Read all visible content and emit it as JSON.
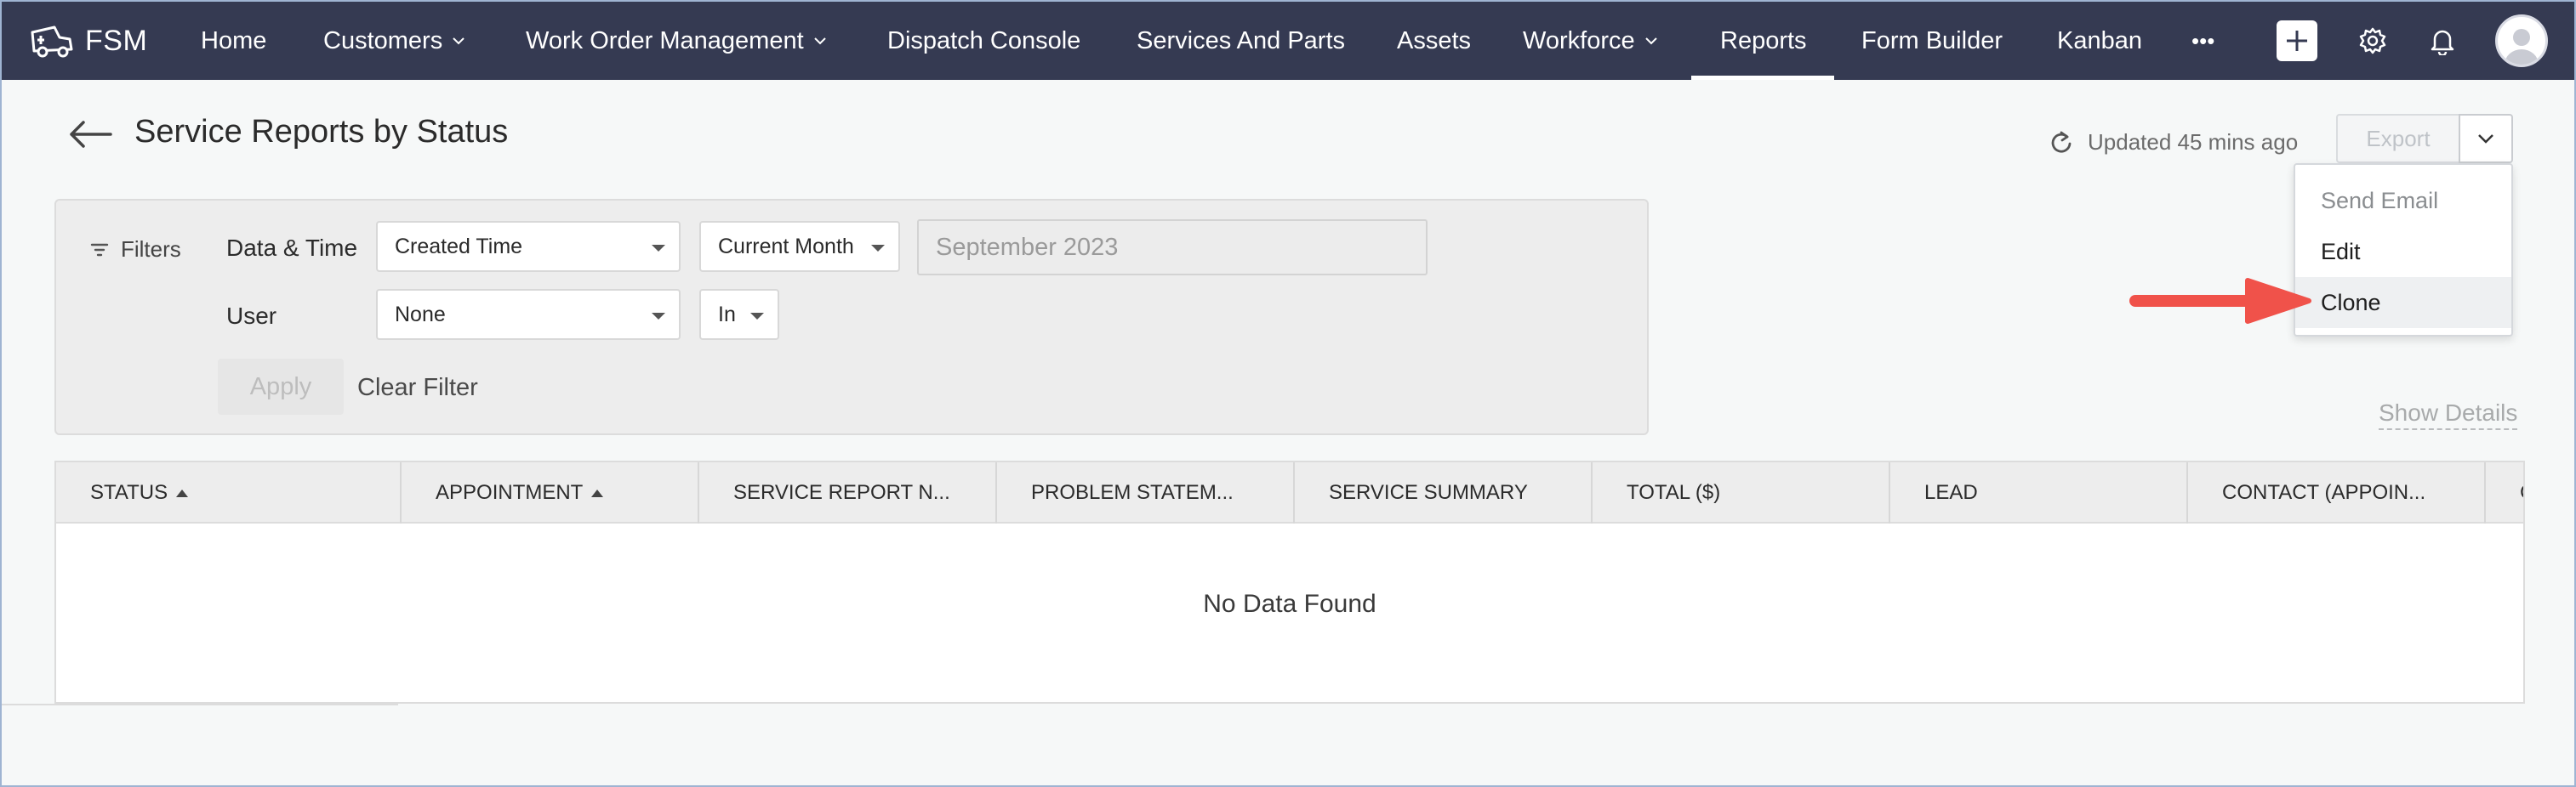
{
  "nav": {
    "brand": "FSM",
    "items": [
      {
        "label": "Home"
      },
      {
        "label": "Customers"
      },
      {
        "label": "Work Order Management"
      },
      {
        "label": "Dispatch Console"
      },
      {
        "label": "Services And Parts"
      },
      {
        "label": "Assets"
      },
      {
        "label": "Workforce"
      },
      {
        "label": "Reports"
      },
      {
        "label": "Form Builder"
      },
      {
        "label": "Kanban"
      }
    ],
    "more": "•••",
    "active": "Reports"
  },
  "header": {
    "title": "Service Reports by Status",
    "updated": "Updated 45 mins ago",
    "export_label": "Export"
  },
  "export_menu": {
    "items": [
      "Send Email",
      "Edit",
      "Clone"
    ],
    "highlighted": "Clone"
  },
  "filters": {
    "label": "Filters",
    "row1_label": "Data & Time",
    "field_select": "Created Time",
    "period_select": "Current Month",
    "date_value": "September 2023",
    "row2_label": "User",
    "user_select": "None",
    "operator_select": "In",
    "apply_label": "Apply",
    "clear_label": "Clear Filter"
  },
  "show_details": "Show Details",
  "table": {
    "columns": [
      "STATUS",
      "APPOINTMENT",
      "SERVICE REPORT N...",
      "PROBLEM STATEM...",
      "SERVICE SUMMARY",
      "TOTAL ($)",
      "LEAD",
      "CONTACT (APPOIN...",
      "C"
    ],
    "empty_message": "No Data Found"
  },
  "colors": {
    "nav_bg": "#353a52",
    "annotation_arrow": "#f0524a"
  }
}
